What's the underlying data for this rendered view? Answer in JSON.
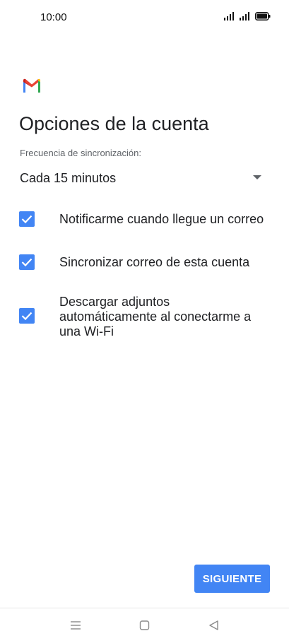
{
  "status_bar": {
    "time": "10:00",
    "icons": [
      "signal-icon",
      "signal-icon",
      "battery-icon"
    ]
  },
  "app": {
    "logo": "gmail-logo"
  },
  "page": {
    "title": "Opciones de la cuenta"
  },
  "sync": {
    "label": "Frecuencia de sincronización:",
    "selected_value": "Cada 15 minutos"
  },
  "options": [
    {
      "label": "Notificarme cuando llegue un correo",
      "checked": true
    },
    {
      "label": "Sincronizar correo de esta cuenta",
      "checked": true
    },
    {
      "label_lines": [
        "Descargar adjuntos",
        "automáticamente al conectarme a",
        "una Wi-Fi"
      ],
      "checked": true
    }
  ],
  "actions": {
    "next_label": "SIGUIENTE"
  },
  "colors": {
    "accent": "#4285f4",
    "text": "#202124",
    "secondary_text": "#5f6368"
  },
  "nav_bar": {
    "icons": [
      "menu-icon",
      "home-icon",
      "back-icon"
    ]
  }
}
